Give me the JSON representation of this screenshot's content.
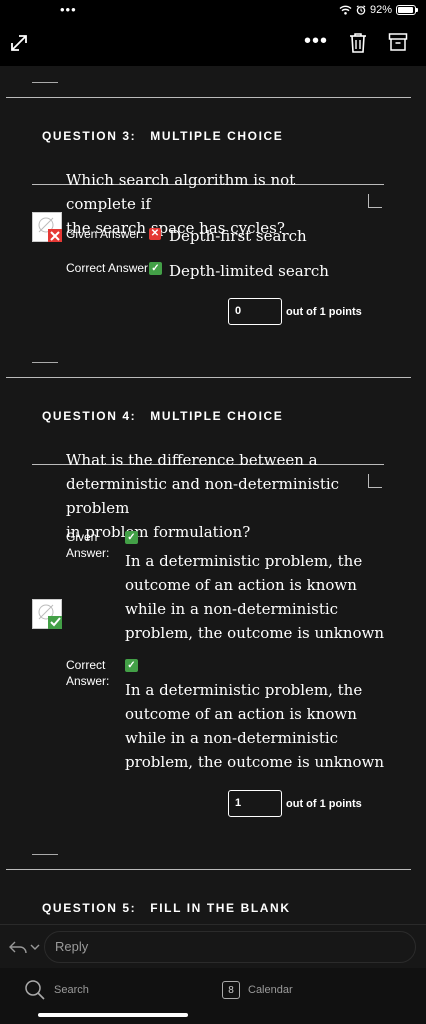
{
  "status_bar": {
    "dots": "•••",
    "battery": "92%"
  },
  "toolbar": {
    "more": "•••"
  },
  "questions": [
    {
      "number": "QUESTION 3:",
      "type": "MULTIPLE CHOICE",
      "text_lines": [
        "Which search algorithm is not complete if",
        "the search space has cycles?"
      ],
      "given_label": "Given Answer:",
      "given_answer": "Depth-first search",
      "correct_label": "Correct Answer:",
      "correct_answer": "Depth-limited search",
      "score": "0",
      "out_of": "out of 1 points",
      "result": "incorrect"
    },
    {
      "number": "QUESTION 4:",
      "type": "MULTIPLE CHOICE",
      "text_lines": [
        "What is the difference between a",
        "deterministic and non-deterministic problem",
        "in problem formulation?"
      ],
      "given_label_lines": [
        "Given",
        "Answer:"
      ],
      "given_answer_lines": [
        "In a deterministic problem, the",
        "outcome of an action is known",
        "while in a non-deterministic",
        "problem, the outcome is unknown"
      ],
      "correct_label_lines": [
        "Correct",
        "Answer:"
      ],
      "correct_answer_lines": [
        "In a deterministic problem, the",
        "outcome of an action is known",
        "while in a non-deterministic",
        "problem, the outcome is unknown"
      ],
      "score": "1",
      "out_of": "out of 1 points",
      "result": "correct"
    },
    {
      "number": "QUESTION 5:",
      "type": "FILL IN THE BLANK"
    }
  ],
  "reply": {
    "placeholder": "Reply"
  },
  "bottom_nav": {
    "search_label": "Search",
    "calendar_day": "8",
    "calendar_label": "Calendar"
  },
  "colors": {
    "background": "#171717",
    "bar": "#000000",
    "incorrect": "#e53935",
    "correct": "#43a047"
  }
}
